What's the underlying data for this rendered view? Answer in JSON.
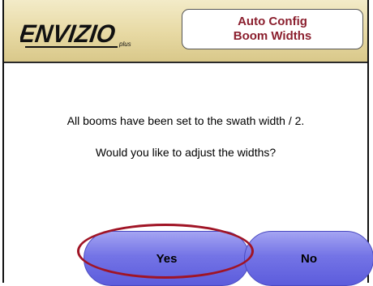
{
  "header": {
    "logo_text": "ENVIZIO",
    "logo_suffix": "plus",
    "title_line1": "Auto Config",
    "title_line2": "Boom Widths"
  },
  "dialog": {
    "message_line1": "All booms have been set to the swath width / 2.",
    "message_line2": "Would you like to adjust the widths?"
  },
  "buttons": {
    "yes_label": "Yes",
    "no_label": "No"
  },
  "colors": {
    "header_bg": "#e7d9a3",
    "title_text": "#8b1f2e",
    "button_fill": "#7474e6",
    "highlight_ring": "#a01425"
  }
}
